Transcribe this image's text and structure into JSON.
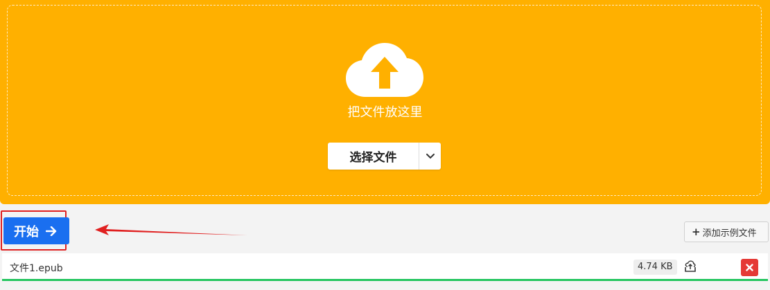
{
  "dropzone": {
    "label": "把文件放这里",
    "icon": "cloud-upload-icon",
    "background": "#ffb000"
  },
  "choose": {
    "label": "选择文件",
    "dropdown_icon": "chevron-down-icon"
  },
  "start": {
    "label": "开始",
    "icon": "arrow-right-icon",
    "color": "#1a6ff0"
  },
  "add_sample": {
    "label": "添加示例文件",
    "icon": "plus-icon"
  },
  "file": {
    "name": "文件1.epub",
    "size": "4.74 KB",
    "upload_icon": "cloud-upload-icon",
    "delete_icon": "close-icon",
    "progress_color": "#22c55e"
  }
}
